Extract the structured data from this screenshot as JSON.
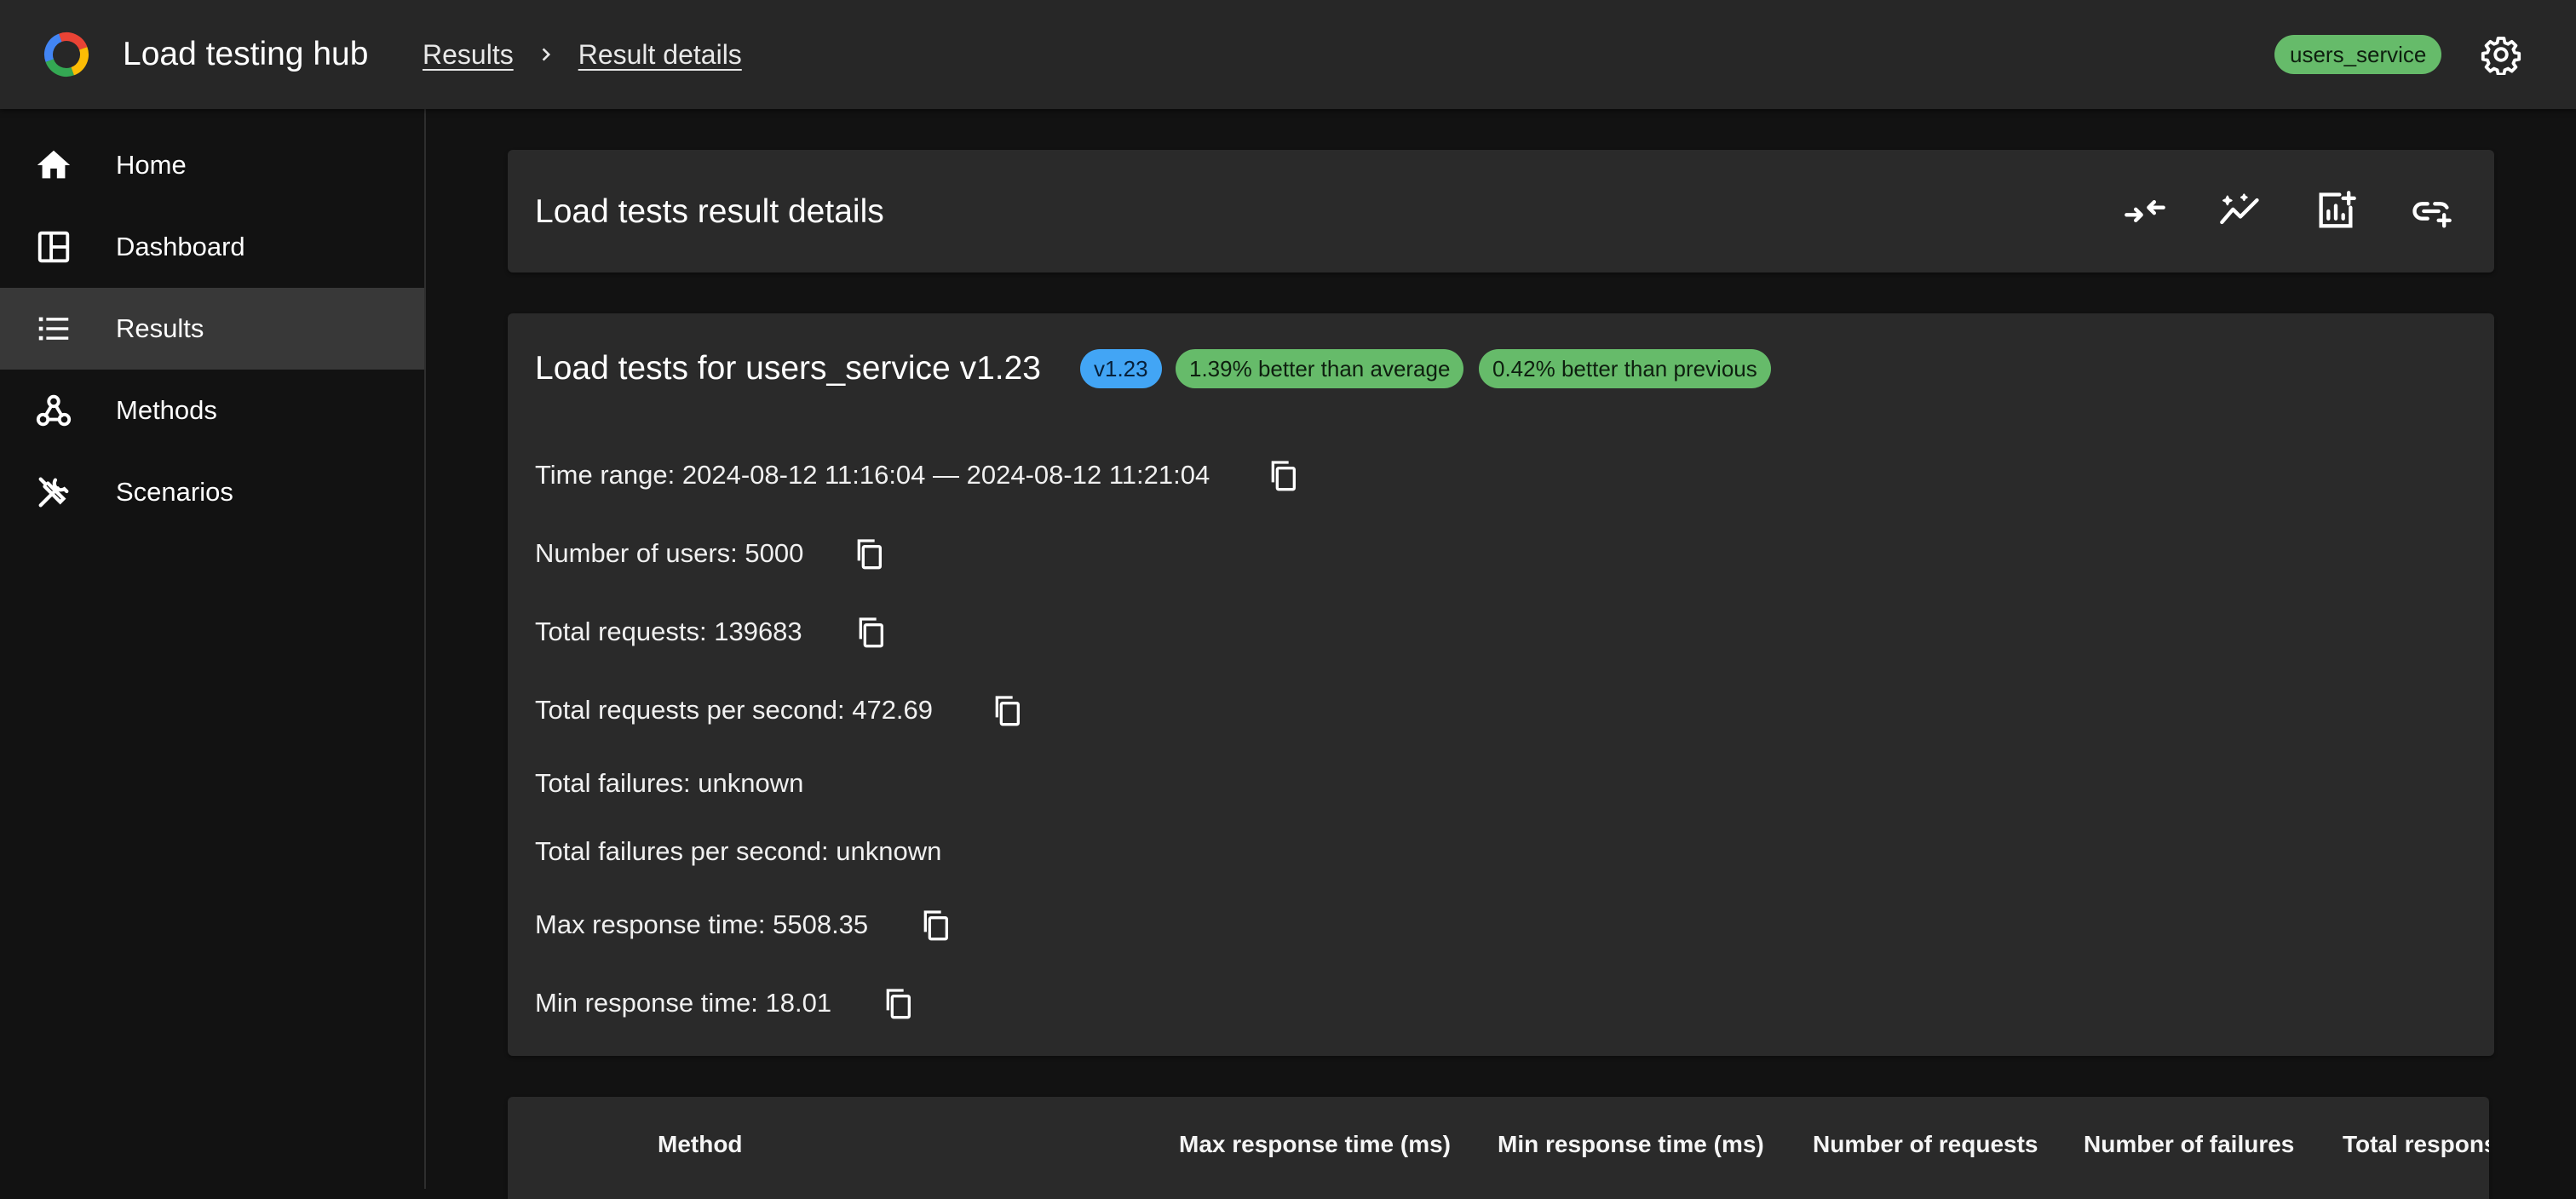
{
  "app": {
    "title": "Load testing hub"
  },
  "breadcrumbs": [
    {
      "label": "Results"
    },
    {
      "label": "Result details"
    }
  ],
  "header": {
    "service_chip": "users_service",
    "settings_icon": "gear-icon"
  },
  "sidebar": {
    "items": [
      {
        "label": "Home",
        "icon": "home-icon",
        "active": false
      },
      {
        "label": "Dashboard",
        "icon": "dashboard-icon",
        "active": false
      },
      {
        "label": "Results",
        "icon": "list-icon",
        "active": true
      },
      {
        "label": "Methods",
        "icon": "webhook-icon",
        "active": false
      },
      {
        "label": "Scenarios",
        "icon": "tools-icon",
        "active": false
      }
    ]
  },
  "details_header": {
    "title": "Load tests result details",
    "tools": [
      "compare-icon",
      "trend-icon",
      "add-chart-icon",
      "add-link-icon"
    ]
  },
  "summary": {
    "title": "Load tests for users_service v1.23",
    "badges": {
      "version": "v1.23",
      "vs_average": "1.39% better than average",
      "vs_previous": "0.42% better than previous"
    },
    "stats": [
      {
        "text": "Time range: 2024-08-12 11:16:04 — 2024-08-12 11:21:04",
        "copyable": true
      },
      {
        "text": "Number of users: 5000",
        "copyable": true
      },
      {
        "text": "Total requests: 139683",
        "copyable": true
      },
      {
        "text": "Total requests per second: 472.69",
        "copyable": true
      },
      {
        "text": "Total failures: unknown",
        "copyable": false
      },
      {
        "text": "Total failures per second: unknown",
        "copyable": false
      },
      {
        "text": "Max response time: 5508.35",
        "copyable": true
      },
      {
        "text": "Min response time: 18.01",
        "copyable": true
      }
    ]
  },
  "methods_table": {
    "columns": [
      "Method",
      "Max response time (ms)",
      "Min response time (ms)",
      "Number of requests",
      "Number of failures",
      "Total respons"
    ]
  },
  "colors": {
    "appbar": "#272727",
    "background": "#121212",
    "card": "#2a2a2a",
    "success": "#66bb6a",
    "info": "#42a5f5"
  }
}
